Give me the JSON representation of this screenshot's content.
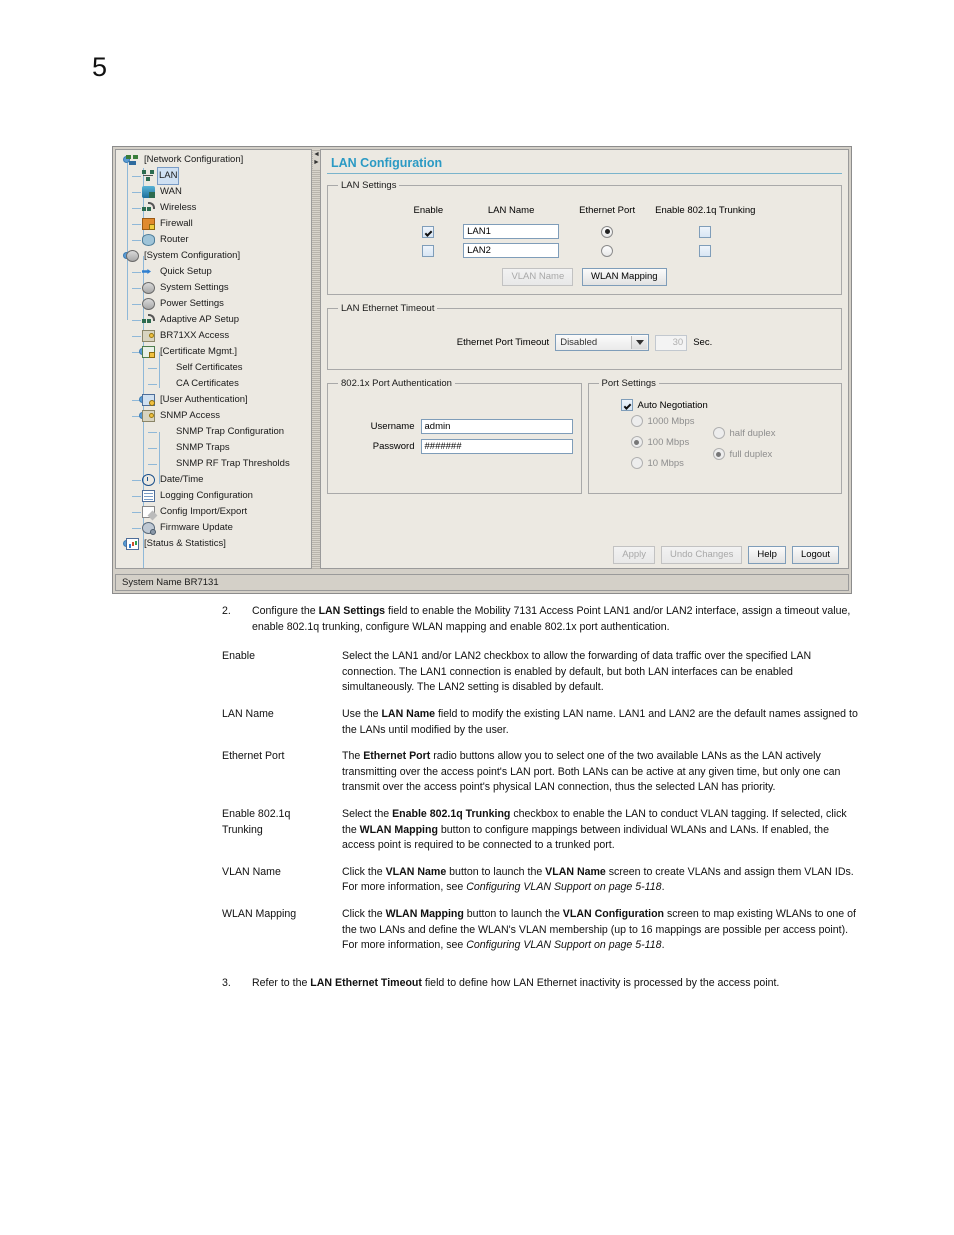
{
  "page_number": "5",
  "app": {
    "title": "LAN Configuration",
    "status_bar": "System Name BR7131",
    "title_color": "#2b9ac4"
  },
  "tree": {
    "items": [
      {
        "label": "[Network Configuration]",
        "icon": "network-icon",
        "level": 0,
        "selected": false
      },
      {
        "label": "LAN",
        "icon": "lan-icon",
        "level": 1,
        "selected": true
      },
      {
        "label": "WAN",
        "icon": "wan-icon",
        "level": 1,
        "selected": false
      },
      {
        "label": "Wireless",
        "icon": "wireless-icon",
        "level": 1,
        "selected": false
      },
      {
        "label": "Firewall",
        "icon": "firewall-icon",
        "level": 1,
        "selected": false
      },
      {
        "label": "Router",
        "icon": "router-icon",
        "level": 1,
        "selected": false
      },
      {
        "label": "[System Configuration]",
        "icon": "system-icon",
        "level": 0,
        "selected": false
      },
      {
        "label": "Quick Setup",
        "icon": "quick-setup-icon",
        "level": 1,
        "selected": false
      },
      {
        "label": "System Settings",
        "icon": "system-settings-icon",
        "level": 1,
        "selected": false
      },
      {
        "label": "Power Settings",
        "icon": "power-settings-icon",
        "level": 1,
        "selected": false
      },
      {
        "label": "Adaptive AP Setup",
        "icon": "adaptive-ap-icon",
        "level": 1,
        "selected": false
      },
      {
        "label": "BR71XX Access",
        "icon": "br71xx-access-icon",
        "level": 1,
        "selected": false
      },
      {
        "label": "[Certificate Mgmt.]",
        "icon": "certificate-icon",
        "level": 1,
        "selected": false
      },
      {
        "label": "Self Certificates",
        "icon": "none",
        "level": 2,
        "selected": false
      },
      {
        "label": "CA Certificates",
        "icon": "none",
        "level": 2,
        "selected": false
      },
      {
        "label": "[User Authentication]",
        "icon": "user-auth-icon",
        "level": 1,
        "selected": false
      },
      {
        "label": "SNMP Access",
        "icon": "snmp-access-icon",
        "level": 1,
        "selected": false
      },
      {
        "label": "SNMP Trap Configuration",
        "icon": "none",
        "level": 2,
        "selected": false
      },
      {
        "label": "SNMP Traps",
        "icon": "none",
        "level": 2,
        "selected": false
      },
      {
        "label": "SNMP RF Trap Thresholds",
        "icon": "none",
        "level": 2,
        "selected": false
      },
      {
        "label": "Date/Time",
        "icon": "clock-icon",
        "level": 1,
        "selected": false
      },
      {
        "label": "Logging Configuration",
        "icon": "logging-icon",
        "level": 1,
        "selected": false
      },
      {
        "label": "Config Import/Export",
        "icon": "import-export-icon",
        "level": 1,
        "selected": false
      },
      {
        "label": "Firmware Update",
        "icon": "firmware-icon",
        "level": 1,
        "selected": false
      },
      {
        "label": "[Status & Statistics]",
        "icon": "statistics-icon",
        "level": 0,
        "selected": false
      }
    ]
  },
  "lan_settings": {
    "legend": "LAN Settings",
    "headers": [
      "Enable",
      "LAN Name",
      "Ethernet Port",
      "Enable 802.1q Trunking"
    ],
    "rows": [
      {
        "enable": true,
        "name": "LAN1",
        "ethernet_port": true,
        "trunking": false
      },
      {
        "enable": false,
        "name": "LAN2",
        "ethernet_port": false,
        "trunking": false
      }
    ],
    "vlan_name_button": "VLAN Name",
    "vlan_name_enabled": false,
    "wlan_mapping_button": "WLAN Mapping",
    "wlan_mapping_enabled": true
  },
  "lan_timeout": {
    "legend": "LAN Ethernet Timeout",
    "label": "Ethernet Port Timeout",
    "value": "Disabled",
    "seconds_value": "30",
    "seconds_unit": "Sec."
  },
  "port_auth": {
    "legend": "802.1x Port Authentication",
    "username_label": "Username",
    "username_value": "admin",
    "password_label": "Password",
    "password_value": "#######"
  },
  "port_settings": {
    "legend": "Port Settings",
    "auto_negotiation_label": "Auto Negotiation",
    "auto_negotiation": true,
    "speeds": [
      {
        "label": "1000 Mbps",
        "selected": false
      },
      {
        "label": "100 Mbps",
        "selected": true
      },
      {
        "label": "10 Mbps",
        "selected": false
      }
    ],
    "duplex": [
      {
        "label": "half duplex",
        "selected": false
      },
      {
        "label": "full duplex",
        "selected": true
      }
    ]
  },
  "actions": [
    {
      "label": "Apply",
      "enabled": false
    },
    {
      "label": "Undo Changes",
      "enabled": false
    },
    {
      "label": "Help",
      "enabled": true
    },
    {
      "label": "Logout",
      "enabled": true
    }
  ],
  "doc": {
    "step2_num": "2.",
    "step2_a": "Configure the ",
    "step2_b": "LAN Settings",
    "step2_c": " field to enable the Mobility 7131 Access Point LAN1 and/or LAN2 interface, assign a timeout value, enable 802.1q trunking, configure WLAN mapping and enable 802.1x port authentication.",
    "defs": [
      {
        "term": "Enable",
        "text": "Select the LAN1 and/or LAN2 checkbox to allow the forwarding of data traffic over the specified LAN connection. The LAN1 connection is enabled by default, but both LAN interfaces can be enabled simultaneously. The LAN2 setting is disabled by default."
      },
      {
        "term": "LAN Name",
        "text": "Use the LAN Name field to modify the existing LAN name. LAN1 and LAN2 are the default names assigned to the LANs until modified by the user."
      },
      {
        "term": "Ethernet Port",
        "text": "The Ethernet Port radio buttons allow you to select one of the two available LANs as the LAN actively transmitting over the access point's LAN port. Both LANs can be active at any given time, but only one can transmit over the access point's physical LAN connection, thus the selected LAN has priority."
      },
      {
        "term": "Enable 802.1q Trunking",
        "text": "Select the Enable 802.1q Trunking checkbox to enable the LAN to conduct VLAN tagging. If selected, click the WLAN Mapping button to configure mappings between individual WLANs and LANs. If enabled, the access point is required to be connected to a trunked port."
      },
      {
        "term": "VLAN Name",
        "text": "Click the VLAN Name button to launch the VLAN Name screen to create VLANs and assign them VLAN IDs. For more information, see Configuring VLAN Support on page 5-118."
      },
      {
        "term": "WLAN Mapping",
        "text": "Click the WLAN Mapping button to launch the VLAN Configuration screen to map existing WLANs to one of the two LANs and define the WLAN's VLAN membership (up to 16 mappings are possible per access point). For more information, see Configuring VLAN Support on page 5-118."
      }
    ],
    "step3_num": "3.",
    "step3_a": "Refer to the ",
    "step3_b": "LAN Ethernet Timeout",
    "step3_c": " field to define how LAN Ethernet inactivity is processed by the access point."
  }
}
